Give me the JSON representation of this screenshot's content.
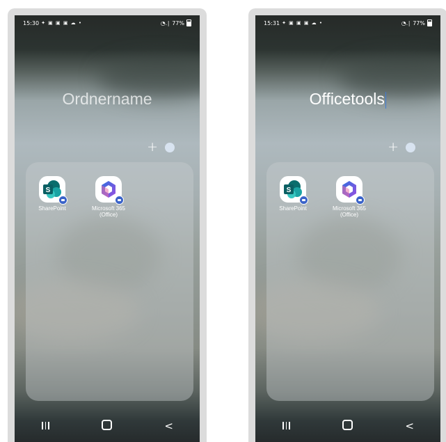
{
  "screens": [
    {
      "status": {
        "time": "15:30",
        "notifications": "✦ ▣ ▣ ▣ ☁  •",
        "signal": "◔.∣",
        "battery": "77%"
      },
      "folder": {
        "title": "",
        "placeholder": "Ordnername",
        "editing": false
      },
      "controls": {
        "add_icon": "plus-icon",
        "color_icon": "color-dot"
      },
      "apps": [
        {
          "name": "SharePoint",
          "icon": "sharepoint-icon"
        },
        {
          "name": "Microsoft 365 (Office)",
          "icon": "microsoft-365-icon"
        }
      ]
    },
    {
      "status": {
        "time": "15:31",
        "notifications": "✦ ▣ ▣ ▣ ☁  •",
        "signal": "◔.∣",
        "battery": "77%"
      },
      "folder": {
        "title": "Officetools",
        "placeholder": "",
        "editing": true
      },
      "controls": {
        "add_icon": "plus-icon",
        "color_icon": "color-dot"
      },
      "apps": [
        {
          "name": "SharePoint",
          "icon": "sharepoint-icon"
        },
        {
          "name": "Microsoft 365 (Office)",
          "icon": "microsoft-365-icon"
        }
      ]
    }
  ],
  "navbar": {
    "recents": "recents-icon",
    "home": "home-icon",
    "back": "back-icon",
    "back_glyph": "<"
  },
  "colors": {
    "caret": "#3d7bd6",
    "badge": "#3a63c9",
    "sharepoint": "#0f7b7b",
    "m365_a": "#7b5ce6",
    "m365_b": "#2f6fe0"
  }
}
